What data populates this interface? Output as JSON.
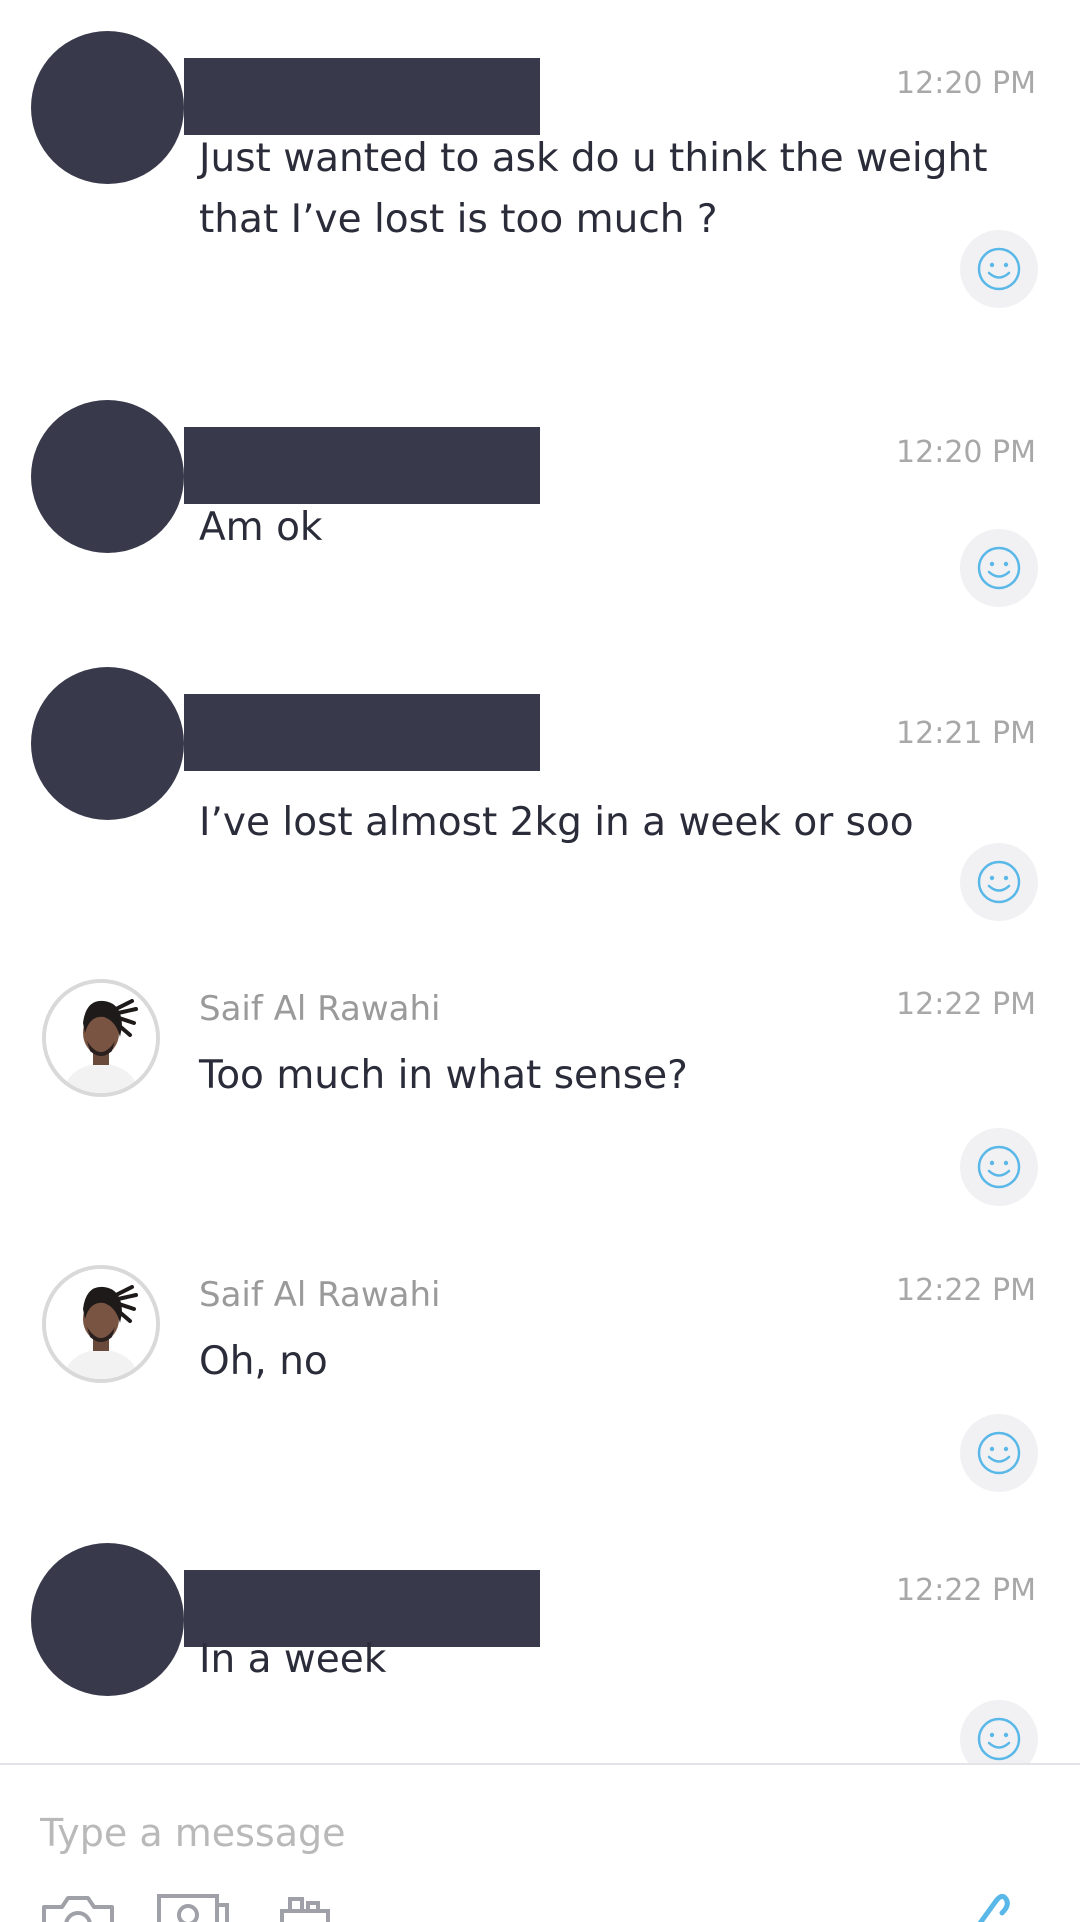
{
  "messages": [
    {
      "sender": "",
      "sender_redacted": true,
      "time": "12:20 PM",
      "text": "Just wanted to ask do u think the weight that I’ve lost is too much ?"
    },
    {
      "sender": "",
      "sender_redacted": true,
      "time": "12:20 PM",
      "text": "Am ok"
    },
    {
      "sender": "",
      "sender_redacted": true,
      "time": "12:21 PM",
      "text": "I’ve lost almost 2kg in a week or soo"
    },
    {
      "sender": "Saif Al Rawahi",
      "sender_redacted": false,
      "time": "12:22 PM",
      "text": "Too much in what sense?"
    },
    {
      "sender": "Saif Al Rawahi",
      "sender_redacted": false,
      "time": "12:22 PM",
      "text": "Oh, no"
    },
    {
      "sender": "",
      "sender_redacted": true,
      "time": "12:22 PM",
      "text": "In a week"
    }
  ],
  "composer": {
    "placeholder": "Type a message",
    "value": ""
  },
  "icons": {
    "reaction": "smiley-icon",
    "toolbar": [
      "camera-icon",
      "image-icon",
      "briefcase-icon",
      "attach-icon"
    ]
  },
  "colors": {
    "redaction": "#383a4c",
    "accent": "#5ab8e8",
    "muted_text": "#a8a8a8"
  }
}
